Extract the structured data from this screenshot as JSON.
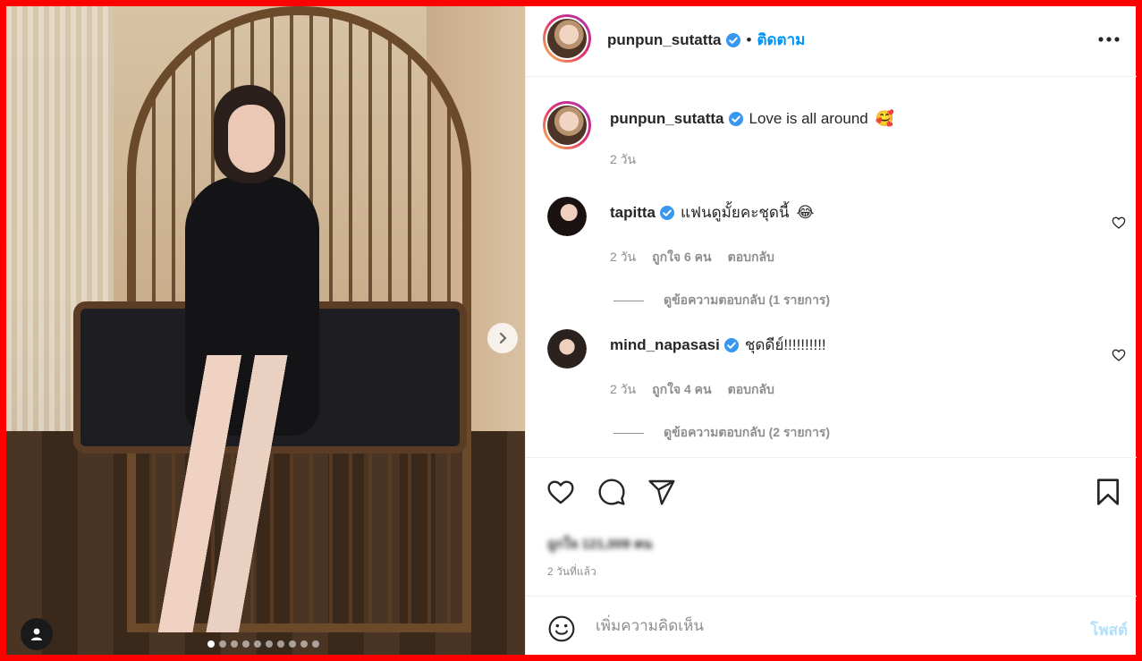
{
  "post": {
    "author": "punpun_sutatta",
    "follow_label": "ติดตาม",
    "separator": "•",
    "caption": "Love is all around",
    "caption_emoji": "🥰",
    "caption_age": "2 วัน",
    "carousel": {
      "total_slides": 10,
      "active_index": 0
    }
  },
  "comments": [
    {
      "username": "tapitta",
      "text": "แฟนดูมั้ยคะชุดนี้",
      "emoji": "😂",
      "age": "2 วัน",
      "likes_label": "ถูกใจ 6 คน",
      "reply_label": "ตอบกลับ",
      "view_replies_label": "ดูข้อความตอบกลับ (1 รายการ)"
    },
    {
      "username": "mind_napasasi",
      "text": "ชุดดีย์!!!!!!!!!!",
      "emoji": "",
      "age": "2 วัน",
      "likes_label": "ถูกใจ 4 คน",
      "reply_label": "ตอบกลับ",
      "view_replies_label": "ดูข้อความตอบกลับ (2 รายการ)"
    }
  ],
  "stats": {
    "likes_label": "ถูกใจ 121,009 คน",
    "posted_ago": "2 วันที่แล้ว"
  },
  "composer": {
    "placeholder": "เพิ่มความคิดเห็น",
    "post_label": "โพสต์"
  },
  "icons": {
    "verified": "verified-badge-icon",
    "more": "more-options-icon",
    "like": "heart-icon",
    "comment": "comment-bubble-icon",
    "share": "paper-plane-icon",
    "save": "bookmark-icon",
    "emoji": "emoji-smile-icon",
    "next": "chevron-right-icon",
    "tags": "user-tag-icon"
  },
  "colors": {
    "accent": "#0095f6",
    "post_disabled": "#b2dffc",
    "muted": "#8e8e8e",
    "frame": "#ff0000"
  }
}
